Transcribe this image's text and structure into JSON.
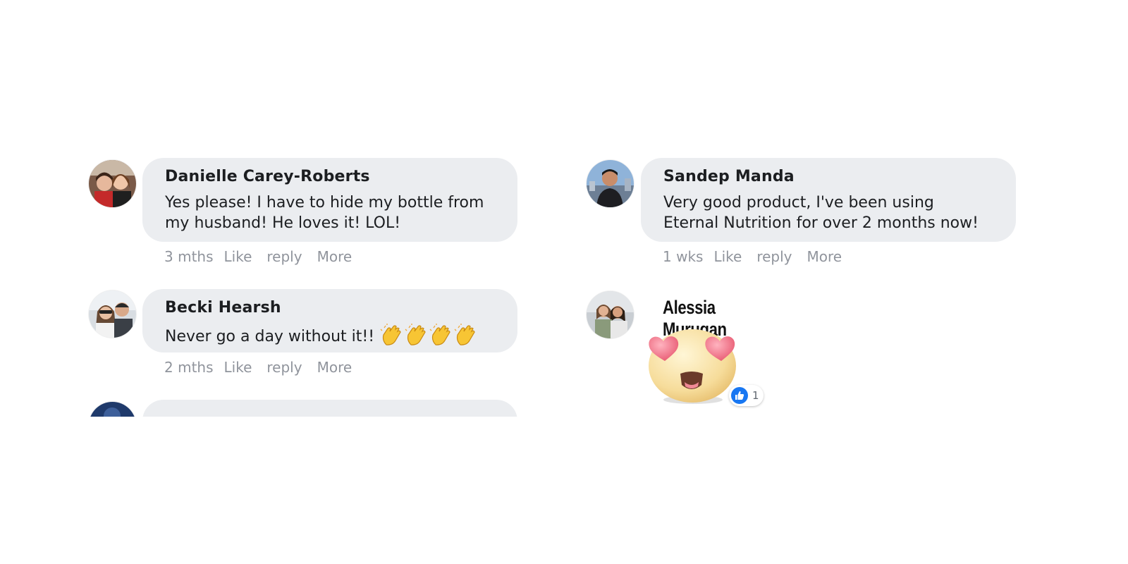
{
  "comments": [
    {
      "author": "Danielle Carey-Roberts",
      "text_line1": "Yes please! I have to hide my bottle from",
      "text_line2": "my husband! He loves it! LOL!",
      "time": "3 mths",
      "like": "Like",
      "reply": "reply",
      "more": "More"
    },
    {
      "author": "Becki Hearsh",
      "text": "Never go a day without it!!",
      "emoji": "clapping-hands x4",
      "time": "2 mths",
      "like": "Like",
      "reply": "reply",
      "more": "More"
    },
    {
      "author": "Sandep Manda",
      "text_line1": "Very good product, I've been using",
      "text_line2": "Eternal Nutrition for over 2 months now!",
      "time": "1 wks",
      "like": "Like",
      "reply": "reply",
      "more": "More"
    },
    {
      "author": "Alessia Murugan",
      "sticker": "heart-eyes-emoji",
      "reaction_count": "1"
    }
  ],
  "colors": {
    "bubble": "#ebedf0",
    "meta": "#90949c",
    "like_blue": "#1877f2"
  }
}
